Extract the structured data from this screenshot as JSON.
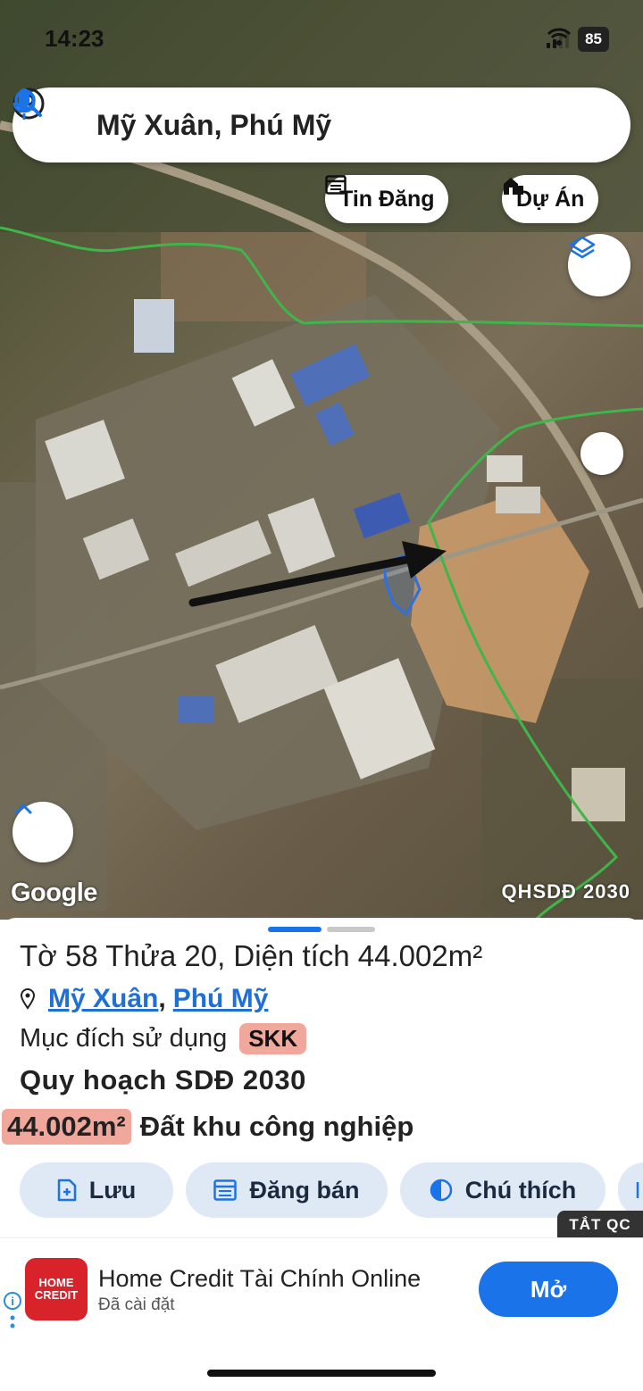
{
  "status_bar": {
    "time": "14:23",
    "battery": "85"
  },
  "search": {
    "title": "Mỹ Xuân, Phú Mỹ"
  },
  "map": {
    "chips": {
      "listings_label": "Tin Đăng",
      "projects_label": "Dự Án"
    },
    "attribution": "Google",
    "plan_overlay_label": "QHSDĐ 2030"
  },
  "parcel": {
    "title": "Tờ 58 Thửa 20, Diện tích 44.002m²",
    "ward": "Mỹ Xuân",
    "separator": ",",
    "district": "Phú Mỹ",
    "purpose_label": "Mục đích sử dụng",
    "purpose_code": "SKK",
    "plan_title": "Quy hoạch SDĐ 2030",
    "plan_area": "44.002m²",
    "plan_land_type": "Đất khu công nghiệp"
  },
  "actions": {
    "save_label": "Lưu",
    "post_label": "Đăng bán",
    "legend_label": "Chú thích"
  },
  "ad": {
    "hide_label": "TẮT QC",
    "logo_line1": "HOME",
    "logo_line2": "CREDIT",
    "name": "Home Credit Tài Chính Online",
    "status": "Đã cài đặt",
    "open_label": "Mở"
  },
  "colors": {
    "accent": "#1a73e8",
    "badge": "#f1a89c",
    "boundary": "#3fb54a",
    "parcel_outline": "#2f6fe0"
  }
}
